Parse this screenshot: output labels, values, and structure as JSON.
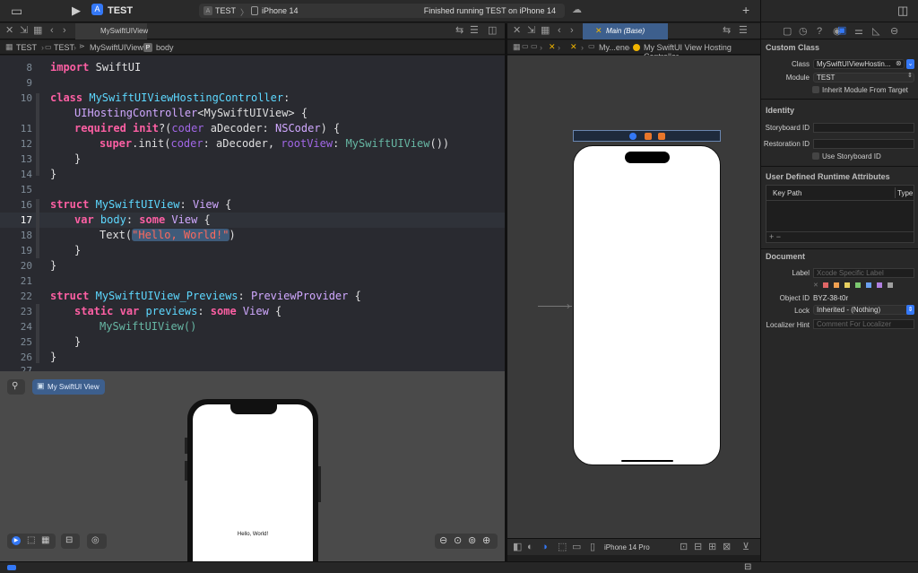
{
  "toolbar": {
    "scheme": "TEST",
    "destination": "iPhone 14",
    "scheme_sep": "〉",
    "status": "Finished running TEST on iPhone 14"
  },
  "left_editor": {
    "tab_label": "MySwiftUIView",
    "breadcrumb": [
      "TEST",
      "TEST",
      "MySwiftUIView",
      "body"
    ],
    "lines": [
      "8",
      "9",
      "10",
      "",
      "11",
      "12",
      "13",
      "14",
      "15",
      "16",
      "17",
      "18",
      "19",
      "20",
      "21",
      "22",
      "23",
      "24",
      "25",
      "26",
      "27"
    ]
  },
  "code": {
    "import_kw": "import",
    "import_mod": "SwiftUI",
    "class_kw": "class",
    "class_name": "MySwiftUIViewHostingController",
    "colon": ":",
    "hosting_type": "UIHostingController",
    "hosting_generic": "<MySwiftUIView> {",
    "required_kw": "required",
    "init_kw": "init",
    "init_args1": "?(",
    "coder_lbl": "coder",
    "init_args2": " aDecoder: ",
    "nscoder": "NSCoder",
    "init_args3": ") {",
    "super_kw": "super",
    "super_init": ".init(",
    "super_coder": "coder",
    "super_mid": ": aDecoder, ",
    "root_view": "rootView",
    "super_mid2": ": ",
    "swiftui_view": "MySwiftUIView",
    "super_end": "())",
    "close": "}",
    "struct_kw": "struct",
    "struct_name": "MySwiftUIView",
    "view_colon": ": ",
    "view_type": "View",
    "brace": " {",
    "var_kw": "var",
    "body_name": "body",
    "some_kw": "some",
    "text_fn": "Text(",
    "hello": "\"Hello, World!\"",
    "paren": ")",
    "previews_name": "MySwiftUIView_Previews",
    "preview_provider": "PreviewProvider",
    "static_kw": "static",
    "previews_var": "previews",
    "call": "MySwiftUIView()"
  },
  "preview": {
    "pin_label": "",
    "view_button": "My SwiftUI View",
    "screen_text": "Hello, World!"
  },
  "right_editor": {
    "tab_label": "Main (Base)",
    "breadcrumb_short": "My...ene",
    "breadcrumb_last": "My SwiftUI View Hosting Controller",
    "device": "iPhone 14 Pro"
  },
  "inspector": {
    "custom_class": "Custom Class",
    "class_label": "Class",
    "class_value": "MySwiftUIViewHostin...",
    "module_label": "Module",
    "module_value": "TEST",
    "inherit_label": "Inherit Module From Target",
    "identity": "Identity",
    "storyboard_id": "Storyboard ID",
    "restoration_id": "Restoration ID",
    "use_storyboard_id": "Use Storyboard ID",
    "runtime_attrs": "User Defined Runtime Attributes",
    "key_path": "Key Path",
    "type": "Type",
    "add_remove": "+ −",
    "document": "Document",
    "label_label": "Label",
    "label_placeholder": "Xcode Specific Label",
    "object_id_label": "Object ID",
    "object_id": "BYZ-38-t0r",
    "lock_label": "Lock",
    "lock_value": "Inherited - (Nothing)",
    "localizer_label": "Localizer Hint",
    "localizer_placeholder": "Comment For Localizer"
  },
  "colors": {
    "accent": "#3478f6",
    "label_swatches": [
      "#e06666",
      "#f0a050",
      "#e8d060",
      "#7cc870",
      "#6aa0f0",
      "#b080e0",
      "#a0a0a0"
    ]
  }
}
